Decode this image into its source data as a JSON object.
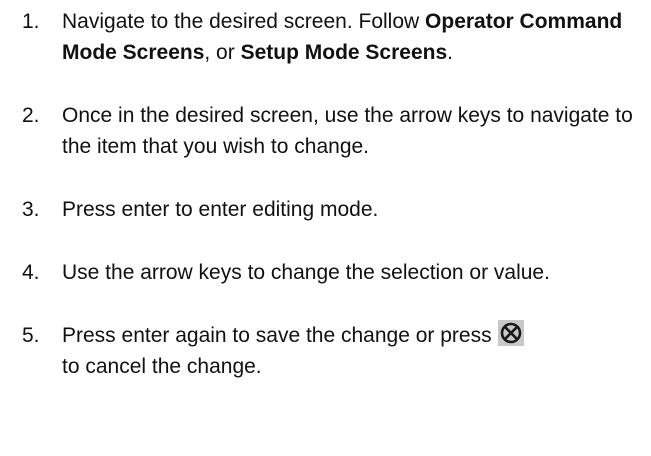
{
  "steps": [
    {
      "number": "1.",
      "part1": "Navigate to the desired screen. Follow ",
      "bold1": "Operator Command Mode Screens",
      "part2": ", or ",
      "bold2": "Setup Mode Screens",
      "part3": "."
    },
    {
      "number": "2.",
      "text": "Once in the desired screen, use the arrow keys to navigate to the item that you wish to change."
    },
    {
      "number": "3.",
      "text": "Press enter to enter editing mode."
    },
    {
      "number": "4.",
      "text": "Use the arrow keys to change the selection or value."
    },
    {
      "number": "5.",
      "before_icon": "Press enter again to save the change or press",
      "icon": "cancel-key-icon",
      "after_icon": "to cancel the change."
    }
  ],
  "colors": {
    "text": "#111111",
    "icon_bg": "#c8c8c8",
    "icon_stroke": "#1a1a1a"
  }
}
